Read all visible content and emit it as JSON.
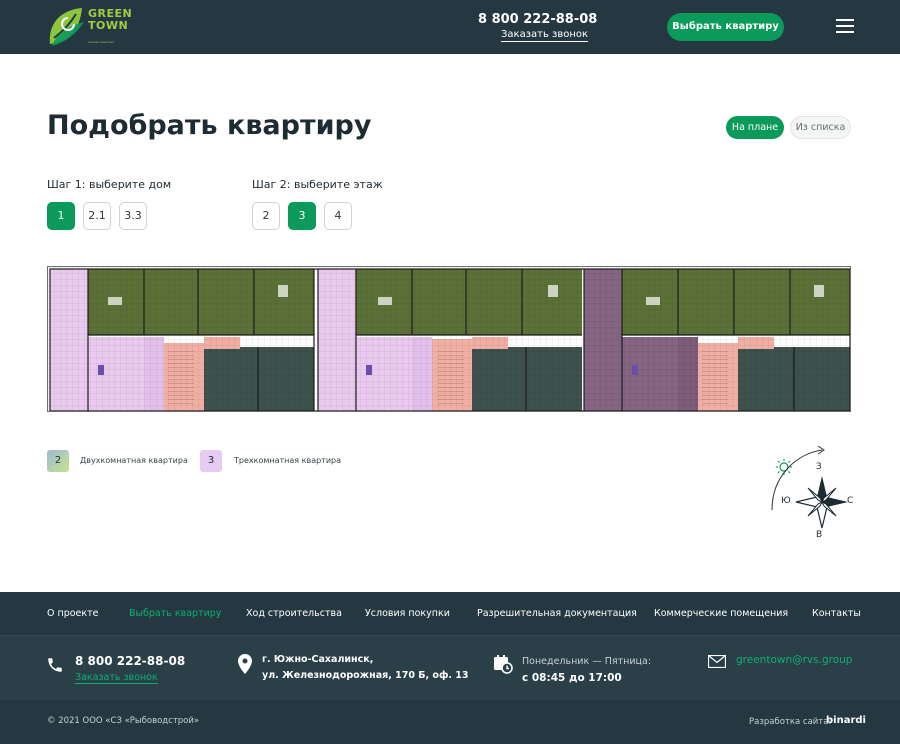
{
  "header": {
    "logo_line1": "GREEN",
    "logo_line2": "TOWN",
    "logo_sub": "жилой комплекс",
    "phone": "8 800 222-88-08",
    "callback": "Заказать звонок",
    "cta": "Выбрать квартиру"
  },
  "main": {
    "title": "Подобрать квартиру",
    "view_plan": "На плане",
    "view_list": "Из списка",
    "step1_label": "Шаг 1: выберите дом",
    "step1_options": [
      "1",
      "2.1",
      "3.3"
    ],
    "step1_selected": "1",
    "step2_label": "Шаг 2: выберите этаж",
    "step2_options": [
      "2",
      "3",
      "4"
    ],
    "step2_selected": "3"
  },
  "legend": {
    "items": [
      {
        "number": "2",
        "label": "Двухкомнатная квартира",
        "color": "#a8c8a0"
      },
      {
        "number": "3",
        "label": "Трехкомнатная квартира",
        "color": "#e6ccf3"
      }
    ]
  },
  "compass": {
    "north": "З",
    "south": "В",
    "west": "Ю",
    "east": "С"
  },
  "footer": {
    "nav": [
      {
        "label": "О проекте",
        "active": false
      },
      {
        "label": "Выбрать квартиру",
        "active": true
      },
      {
        "label": "Ход строительства",
        "active": false
      },
      {
        "label": "Условия покупки",
        "active": false
      },
      {
        "label": "Разрешительная документация",
        "active": false
      },
      {
        "label": "Коммерческие помещения",
        "active": false
      },
      {
        "label": "Контакты",
        "active": false
      }
    ],
    "phone": "8 800 222-88-08",
    "callback": "Заказать звонок",
    "address_line1": "г. Южно-Сахалинск,",
    "address_line2": "ул. Железнодорожная, 170 Б, оф. 13",
    "hours_label": "Понедельник — Пятница:",
    "hours_value": "с 08:45 до 17:00",
    "email": "greentown@rvs.group",
    "copyright": "© 2021 ООО «СЗ «Рыбоводстрой»",
    "dev_label": "Разработка сайта:",
    "dev_brand": "binardi"
  },
  "colors": {
    "header_bg": "#253841",
    "accent": "#0b9a5a",
    "plan_green": "#5a7036",
    "plan_dark": "#3e524d",
    "plan_pink": "#f1b2a8",
    "plan_lilac": "#e6ccf3",
    "plan_purple": "#866583"
  }
}
